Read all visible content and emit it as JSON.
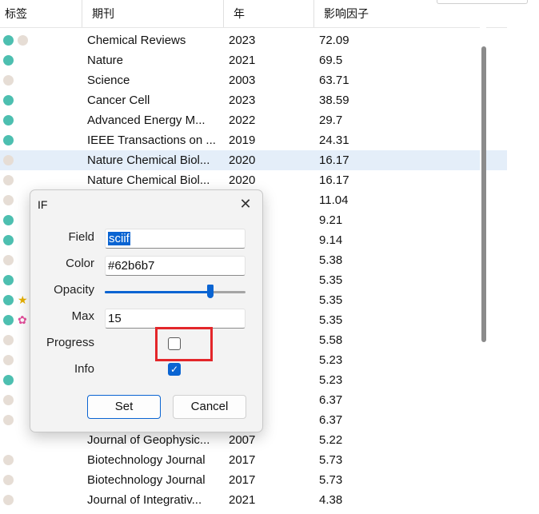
{
  "table": {
    "headers": [
      "标签",
      "期刊",
      "年",
      "影响因子"
    ],
    "rows": [
      {
        "tags": [
          "teal",
          "beige"
        ],
        "journal": "Chemical Reviews",
        "year": "2023",
        "if": "72.09"
      },
      {
        "tags": [
          "teal"
        ],
        "journal": "Nature",
        "year": "2021",
        "if": "69.5"
      },
      {
        "tags": [
          "beige"
        ],
        "journal": "Science",
        "year": "2003",
        "if": "63.71"
      },
      {
        "tags": [
          "teal"
        ],
        "journal": "Cancer Cell",
        "year": "2023",
        "if": "38.59"
      },
      {
        "tags": [
          "teal"
        ],
        "journal": "Advanced Energy M...",
        "year": "2022",
        "if": "29.7"
      },
      {
        "tags": [
          "teal"
        ],
        "journal": "IEEE Transactions on ...",
        "year": "2019",
        "if": "24.31"
      },
      {
        "tags": [
          "beige"
        ],
        "journal": "Nature Chemical Biol...",
        "year": "2020",
        "if": "16.17",
        "selected": true
      },
      {
        "tags": [
          "beige"
        ],
        "journal": "Nature Chemical Biol...",
        "year": "2020",
        "if": "16.17"
      },
      {
        "tags": [
          "beige"
        ],
        "journal": "",
        "year": "",
        "if": "11.04"
      },
      {
        "tags": [
          "teal"
        ],
        "journal": "",
        "year": "",
        "if": "9.21"
      },
      {
        "tags": [
          "teal"
        ],
        "journal": "",
        "year": "",
        "if": "9.14"
      },
      {
        "tags": [
          "beige"
        ],
        "journal": "",
        "year": "",
        "if": "5.38"
      },
      {
        "tags": [
          "teal"
        ],
        "journal": "",
        "year": "",
        "if": "5.35"
      },
      {
        "tags": [
          "teal",
          "star"
        ],
        "journal": "",
        "year": "",
        "if": "5.35"
      },
      {
        "tags": [
          "teal",
          "flower"
        ],
        "journal": "",
        "year": "",
        "if": "5.35"
      },
      {
        "tags": [
          "beige"
        ],
        "journal": "",
        "year": "",
        "if": "5.58"
      },
      {
        "tags": [
          "beige"
        ],
        "journal": "",
        "year": "",
        "if": "5.23"
      },
      {
        "tags": [
          "teal"
        ],
        "journal": "",
        "year": "",
        "if": "5.23"
      },
      {
        "tags": [
          "beige"
        ],
        "journal": "",
        "year": "",
        "if": "6.37"
      },
      {
        "tags": [
          "beige"
        ],
        "journal": "",
        "year": "",
        "if": "6.37"
      },
      {
        "tags": [],
        "journal": "Journal of Geophysic...",
        "year": "2007",
        "if": "5.22"
      },
      {
        "tags": [
          "beige"
        ],
        "journal": "Biotechnology Journal",
        "year": "2017",
        "if": "5.73"
      },
      {
        "tags": [
          "beige"
        ],
        "journal": "Biotechnology Journal",
        "year": "2017",
        "if": "5.73"
      },
      {
        "tags": [
          "beige"
        ],
        "journal": "Journal of Integrativ...",
        "year": "2021",
        "if": "4.38"
      }
    ]
  },
  "colors": {
    "teal": "#4dbfb0",
    "beige": "#e6ddd5",
    "selected_row": "#e4eef9",
    "accent": "#0a64d2",
    "highlight_box": "#e3262a"
  },
  "dialog": {
    "title": "IF",
    "close_icon": "close-icon",
    "field_label": "Field",
    "field_value": "sciif",
    "color_label": "Color",
    "color_value": "#62b6b7",
    "opacity_label": "Opacity",
    "opacity_value": 0.75,
    "max_label": "Max",
    "max_value": "15",
    "progress_label": "Progress",
    "progress_checked": false,
    "info_label": "Info",
    "info_checked": true,
    "set_label": "Set",
    "cancel_label": "Cancel"
  }
}
